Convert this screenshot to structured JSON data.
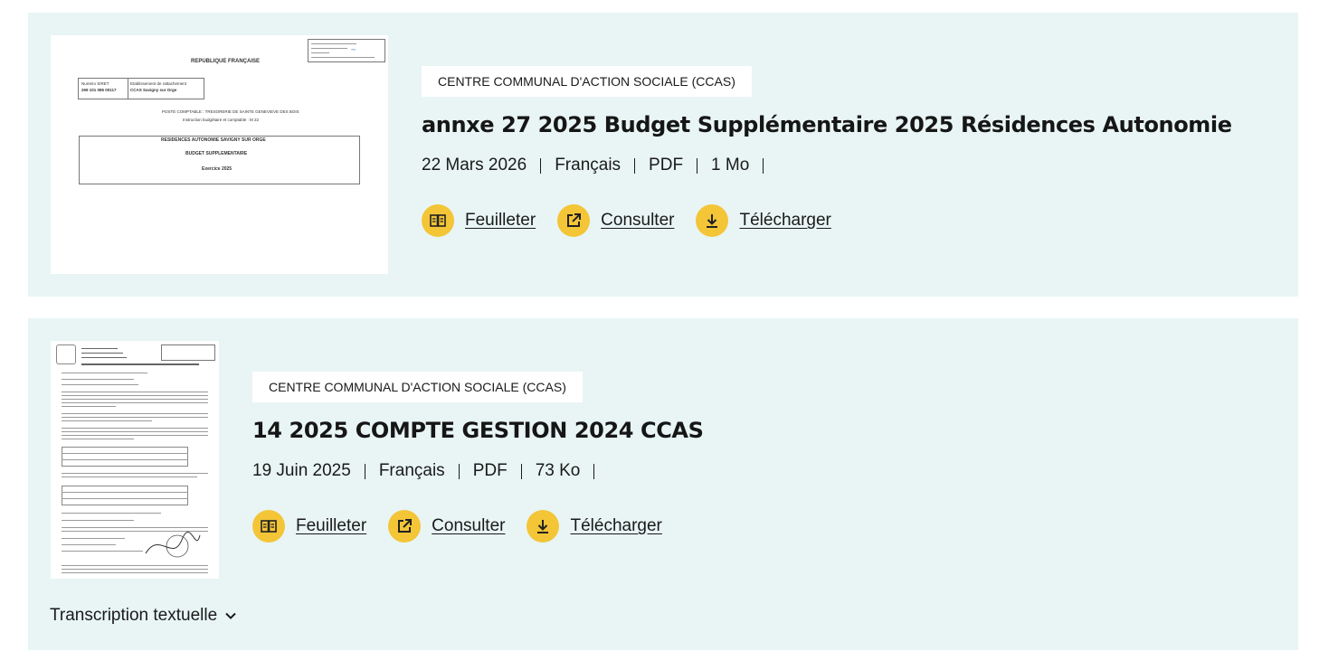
{
  "documents": [
    {
      "category": "CENTRE COMMUNAL D'ACTION SOCIALE (CCAS)",
      "title": "annxe 27 2025 Budget Supplémentaire 2025 Résidences Autonomie",
      "date": "22 Mars 2026",
      "language": "Français",
      "format": "PDF",
      "size": "1 Mo",
      "actions": {
        "browse": "Feuilleter",
        "view": "Consulter",
        "download": "Télécharger"
      },
      "thumbnail": {
        "header": "REPUBLIQUE FRANÇAISE",
        "siret_label": "Numéro SIRET",
        "siret_value": "269 101 085 00117",
        "attach_label": "Etablissement de rattachement",
        "attach_value": "CCAS Savigny sur Orge",
        "poste": "POSTE COMPTABLE : TRESORERIE DE SAINTE GENEVIEVE DES BOIS",
        "instruction": "Instruction budgétaire et comptable : M 22",
        "box_line1": "RESIDENCES AUTONOMIE SAVIGNY SUR ORGE",
        "box_line2": "BUDGET SUPPLEMENTAIRE",
        "box_line3": "Exercice 2025"
      }
    },
    {
      "category": "CENTRE COMMUNAL D'ACTION SOCIALE (CCAS)",
      "title": "14 2025 COMPTE GESTION 2024 CCAS",
      "date": "19 Juin 2025",
      "language": "Français",
      "format": "PDF",
      "size": "73 Ko",
      "actions": {
        "browse": "Feuilleter",
        "view": "Consulter",
        "download": "Télécharger"
      },
      "transcription": "Transcription textuelle"
    }
  ],
  "colors": {
    "card_bg": "#e8f5f4",
    "icon_bg": "#f3c537"
  },
  "icons": [
    "book-icon",
    "external-link-icon",
    "download-icon",
    "chevron-down-icon"
  ]
}
